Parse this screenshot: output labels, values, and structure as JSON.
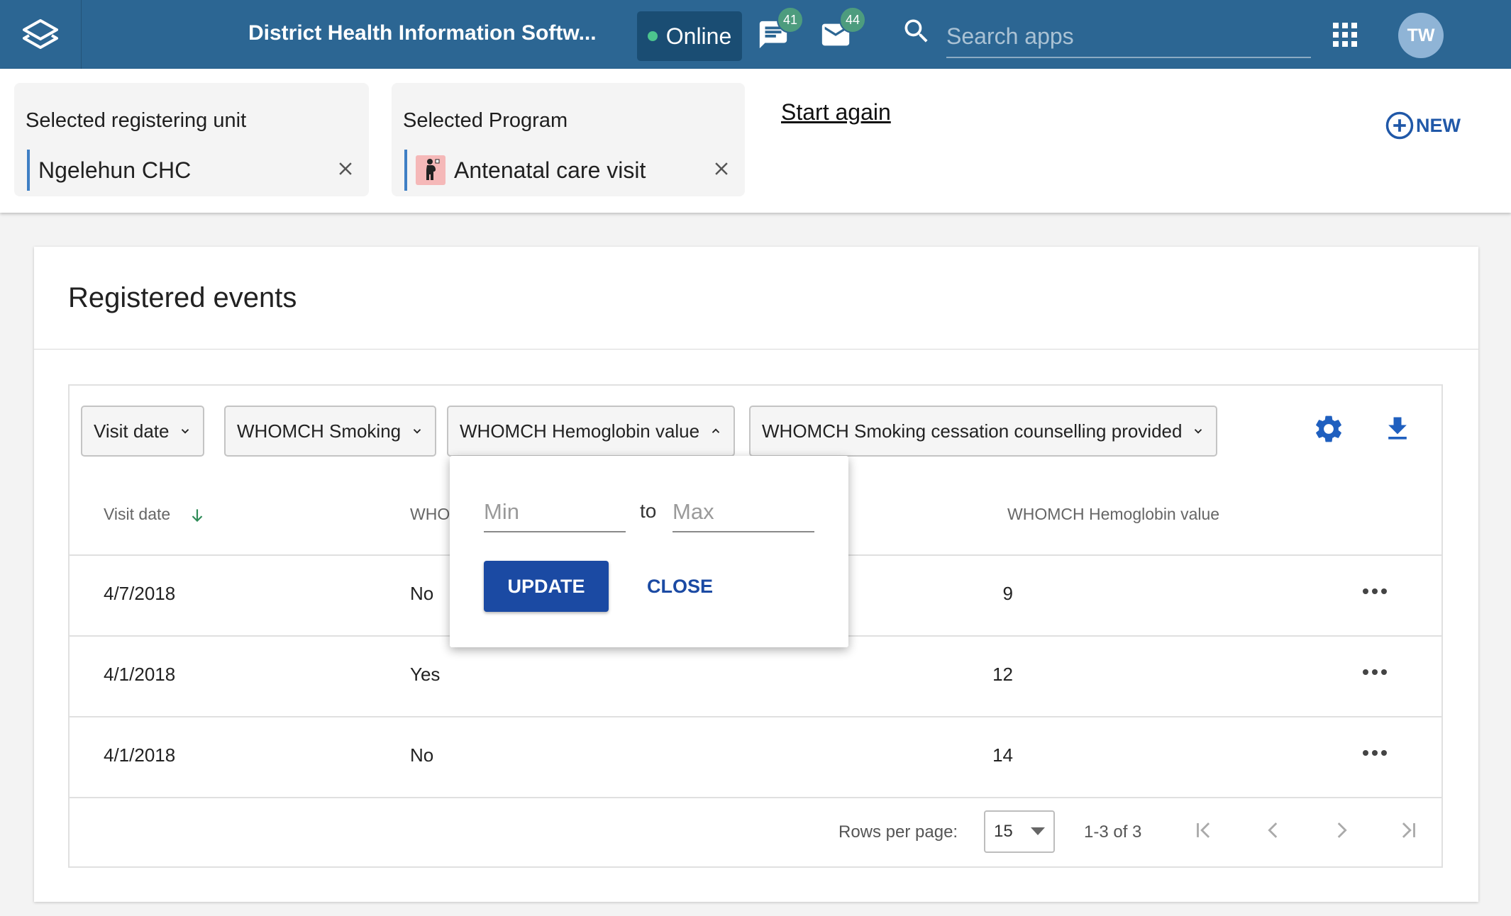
{
  "header": {
    "title": "District Health Information Softw...",
    "online_label": "Online",
    "messages_count": "41",
    "interpretations_count": "44",
    "search_placeholder": "Search apps",
    "user_initials": "TW"
  },
  "selection": {
    "unit_label": "Selected registering unit",
    "unit_value": "Ngelehun CHC",
    "program_label": "Selected Program",
    "program_value": "Antenatal care visit",
    "start_again": "Start again",
    "new_label": "NEW"
  },
  "events": {
    "title": "Registered events",
    "filters": [
      {
        "label": "Visit date"
      },
      {
        "label": "WHOMCH Smoking"
      },
      {
        "label": "WHOMCH Hemoglobin value"
      },
      {
        "label": "WHOMCH Smoking cessation counselling provided"
      }
    ],
    "columns": {
      "visit_date": "Visit date",
      "smoking_truncated": "WHO",
      "hemoglobin": "WHOMCH Hemoglobin value"
    },
    "rows": [
      {
        "visit_date": "4/7/2018",
        "smoking": "No",
        "hemoglobin": "9"
      },
      {
        "visit_date": "4/1/2018",
        "smoking": "Yes",
        "hemoglobin": "12"
      },
      {
        "visit_date": "4/1/2018",
        "smoking": "No",
        "hemoglobin": "14"
      }
    ],
    "pagination": {
      "rows_per_page_label": "Rows per page:",
      "rows_per_page": "15",
      "range": "1-3 of 3"
    }
  },
  "popover": {
    "min_placeholder": "Min",
    "to_label": "to",
    "max_placeholder": "Max",
    "update_label": "UPDATE",
    "close_label": "CLOSE"
  },
  "colors": {
    "header_bg": "#2c6693",
    "accent": "#1b4aa3",
    "online_dot": "#4cc48e",
    "badge": "#4d9c7e"
  }
}
